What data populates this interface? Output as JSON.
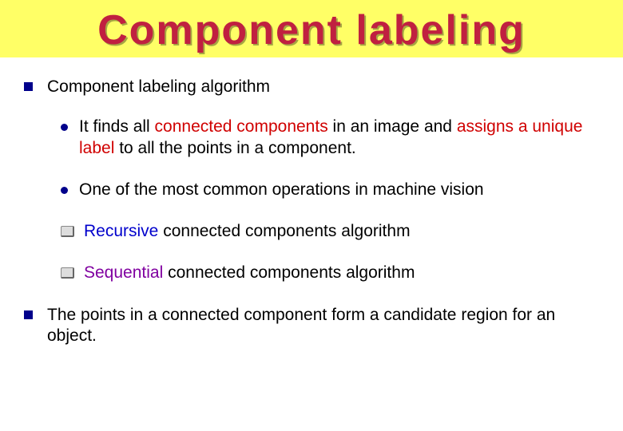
{
  "title": "Component labeling",
  "main": {
    "items": [
      {
        "text": "Component labeling algorithm",
        "sub": [
          {
            "type": "dot",
            "prefix": "It finds all ",
            "hl1": "connected components",
            "mid": " in an image and ",
            "hl2": "assigns a unique label",
            "suffix": " to all the points in a component."
          },
          {
            "type": "dot",
            "text": "One of the most common operations in machine vision"
          },
          {
            "type": "key",
            "hl": "Recursive",
            "suffix": " connected components algorithm"
          },
          {
            "type": "key",
            "hl": "Sequential",
            "suffix": " connected components algorithm"
          }
        ]
      },
      {
        "text": "The points in a connected component form a candidate region for an object."
      }
    ]
  }
}
